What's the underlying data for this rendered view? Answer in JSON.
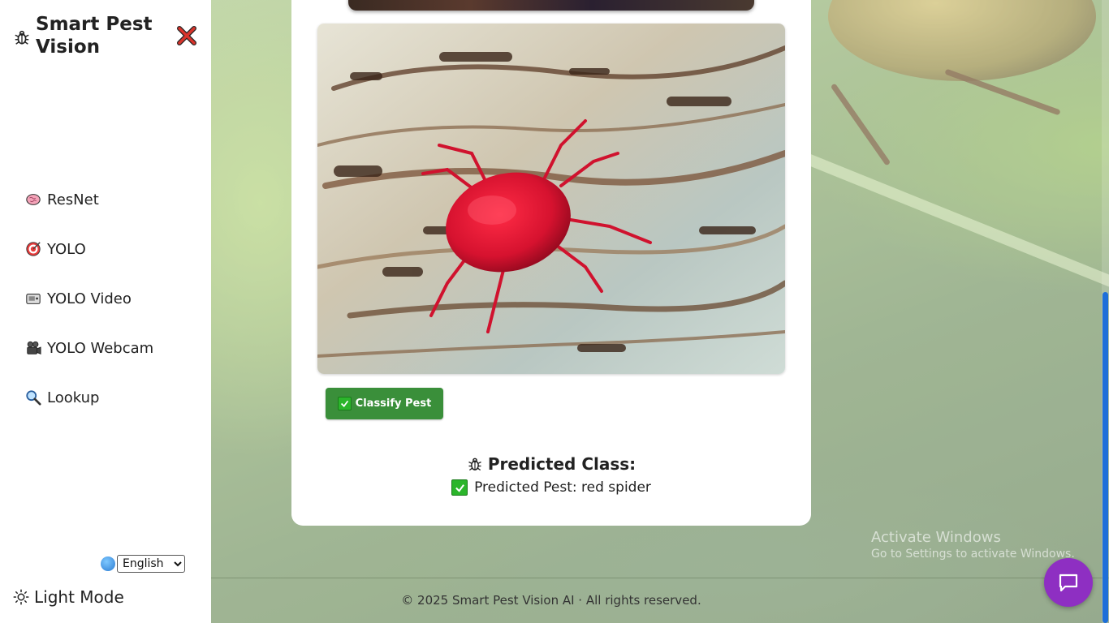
{
  "sidebar": {
    "brand_title": "Smart Pest Vision",
    "nav_items": [
      {
        "label": "ResNet",
        "icon": "brain-icon"
      },
      {
        "label": "YOLO",
        "icon": "target-icon"
      },
      {
        "label": "YOLO Video",
        "icon": "video-camera-icon"
      },
      {
        "label": "YOLO Webcam",
        "icon": "movie-camera-icon"
      },
      {
        "label": "Lookup",
        "icon": "magnifier-icon"
      }
    ],
    "language": {
      "selected": "English",
      "options": [
        "English"
      ]
    },
    "theme_toggle_label": "Light Mode"
  },
  "main": {
    "classify_button_label": "Classify Pest",
    "result_title": "Predicted Class:",
    "result_text": "Predicted Pest: red spider"
  },
  "footer": {
    "text": "© 2025 Smart Pest Vision AI · All rights reserved."
  },
  "watermark": {
    "line1": "Activate Windows",
    "line2": "Go to Settings to activate Windows."
  },
  "colors": {
    "accent_button": "#3a8f3a",
    "chat_button": "#8e2fc2",
    "close_icon": "#d9342b",
    "scroll_thumb": "#1e6fd9"
  }
}
